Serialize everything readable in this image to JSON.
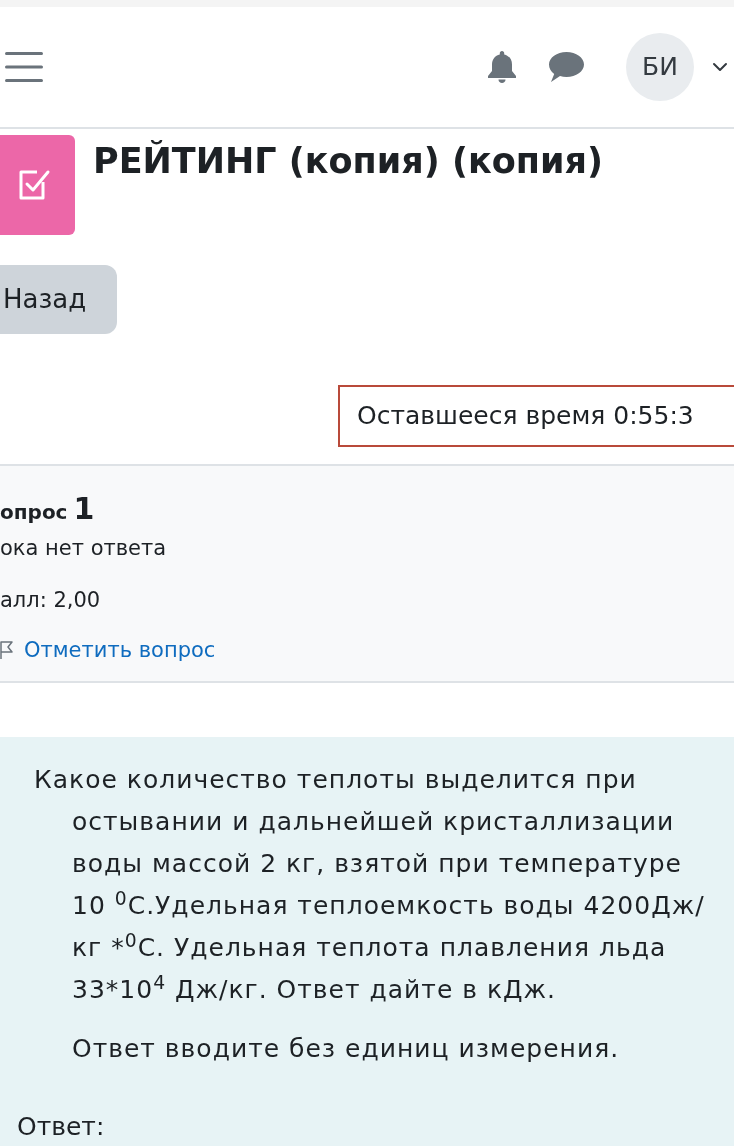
{
  "navbar": {
    "avatar_initials": "БИ"
  },
  "activity": {
    "title": "РЕЙТИНГ (копия) (копия)"
  },
  "back_button": "Назад",
  "timer": {
    "label": "Оставшееся время 0:55:3"
  },
  "question_info": {
    "label": "опрос",
    "number": "1",
    "status": "ока нет ответа",
    "mark": "алл: 2,00",
    "flag_link": "Отметить вопрос",
    "flagged": false
  },
  "question": {
    "paragraphs": [
      "Какое количество теплоты выделится при остывании и дальнейшей кристаллизации воды массой 2 кг, взятой при температуре 10 $^{0}$С.Удельная теплоемкость воды 4200Дж/кг *$^{0}$С. Удельная теплота плавления льда 33*10$^{4}$ Дж/кг. Ответ дайте в кДж.",
      "Ответ вводите без единиц измерения."
    ],
    "answer_label": "Ответ:"
  }
}
